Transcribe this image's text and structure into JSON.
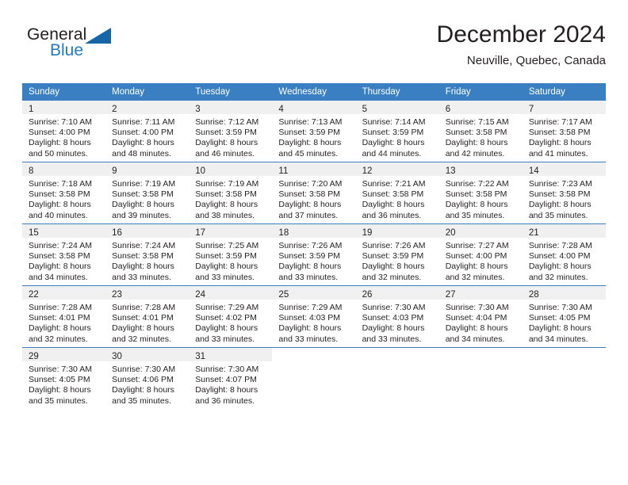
{
  "brand": {
    "name_part1": "General",
    "name_part2": "Blue",
    "flag_color": "#1565a8",
    "blue_color": "#1f7bc1"
  },
  "header": {
    "title": "December 2024",
    "subtitle": "Neuville, Quebec, Canada"
  },
  "theme": {
    "header_bar_color": "#3a7fc1",
    "day_band_color": "#f0f0f0",
    "text_color": "#231f20"
  },
  "weekdays": [
    "Sunday",
    "Monday",
    "Tuesday",
    "Wednesday",
    "Thursday",
    "Friday",
    "Saturday"
  ],
  "weeks": [
    [
      {
        "day": "1",
        "sunrise": "Sunrise: 7:10 AM",
        "sunset": "Sunset: 4:00 PM",
        "daylight1": "Daylight: 8 hours",
        "daylight2": "and 50 minutes."
      },
      {
        "day": "2",
        "sunrise": "Sunrise: 7:11 AM",
        "sunset": "Sunset: 4:00 PM",
        "daylight1": "Daylight: 8 hours",
        "daylight2": "and 48 minutes."
      },
      {
        "day": "3",
        "sunrise": "Sunrise: 7:12 AM",
        "sunset": "Sunset: 3:59 PM",
        "daylight1": "Daylight: 8 hours",
        "daylight2": "and 46 minutes."
      },
      {
        "day": "4",
        "sunrise": "Sunrise: 7:13 AM",
        "sunset": "Sunset: 3:59 PM",
        "daylight1": "Daylight: 8 hours",
        "daylight2": "and 45 minutes."
      },
      {
        "day": "5",
        "sunrise": "Sunrise: 7:14 AM",
        "sunset": "Sunset: 3:59 PM",
        "daylight1": "Daylight: 8 hours",
        "daylight2": "and 44 minutes."
      },
      {
        "day": "6",
        "sunrise": "Sunrise: 7:15 AM",
        "sunset": "Sunset: 3:58 PM",
        "daylight1": "Daylight: 8 hours",
        "daylight2": "and 42 minutes."
      },
      {
        "day": "7",
        "sunrise": "Sunrise: 7:17 AM",
        "sunset": "Sunset: 3:58 PM",
        "daylight1": "Daylight: 8 hours",
        "daylight2": "and 41 minutes."
      }
    ],
    [
      {
        "day": "8",
        "sunrise": "Sunrise: 7:18 AM",
        "sunset": "Sunset: 3:58 PM",
        "daylight1": "Daylight: 8 hours",
        "daylight2": "and 40 minutes."
      },
      {
        "day": "9",
        "sunrise": "Sunrise: 7:19 AM",
        "sunset": "Sunset: 3:58 PM",
        "daylight1": "Daylight: 8 hours",
        "daylight2": "and 39 minutes."
      },
      {
        "day": "10",
        "sunrise": "Sunrise: 7:19 AM",
        "sunset": "Sunset: 3:58 PM",
        "daylight1": "Daylight: 8 hours",
        "daylight2": "and 38 minutes."
      },
      {
        "day": "11",
        "sunrise": "Sunrise: 7:20 AM",
        "sunset": "Sunset: 3:58 PM",
        "daylight1": "Daylight: 8 hours",
        "daylight2": "and 37 minutes."
      },
      {
        "day": "12",
        "sunrise": "Sunrise: 7:21 AM",
        "sunset": "Sunset: 3:58 PM",
        "daylight1": "Daylight: 8 hours",
        "daylight2": "and 36 minutes."
      },
      {
        "day": "13",
        "sunrise": "Sunrise: 7:22 AM",
        "sunset": "Sunset: 3:58 PM",
        "daylight1": "Daylight: 8 hours",
        "daylight2": "and 35 minutes."
      },
      {
        "day": "14",
        "sunrise": "Sunrise: 7:23 AM",
        "sunset": "Sunset: 3:58 PM",
        "daylight1": "Daylight: 8 hours",
        "daylight2": "and 35 minutes."
      }
    ],
    [
      {
        "day": "15",
        "sunrise": "Sunrise: 7:24 AM",
        "sunset": "Sunset: 3:58 PM",
        "daylight1": "Daylight: 8 hours",
        "daylight2": "and 34 minutes."
      },
      {
        "day": "16",
        "sunrise": "Sunrise: 7:24 AM",
        "sunset": "Sunset: 3:58 PM",
        "daylight1": "Daylight: 8 hours",
        "daylight2": "and 33 minutes."
      },
      {
        "day": "17",
        "sunrise": "Sunrise: 7:25 AM",
        "sunset": "Sunset: 3:59 PM",
        "daylight1": "Daylight: 8 hours",
        "daylight2": "and 33 minutes."
      },
      {
        "day": "18",
        "sunrise": "Sunrise: 7:26 AM",
        "sunset": "Sunset: 3:59 PM",
        "daylight1": "Daylight: 8 hours",
        "daylight2": "and 33 minutes."
      },
      {
        "day": "19",
        "sunrise": "Sunrise: 7:26 AM",
        "sunset": "Sunset: 3:59 PM",
        "daylight1": "Daylight: 8 hours",
        "daylight2": "and 32 minutes."
      },
      {
        "day": "20",
        "sunrise": "Sunrise: 7:27 AM",
        "sunset": "Sunset: 4:00 PM",
        "daylight1": "Daylight: 8 hours",
        "daylight2": "and 32 minutes."
      },
      {
        "day": "21",
        "sunrise": "Sunrise: 7:28 AM",
        "sunset": "Sunset: 4:00 PM",
        "daylight1": "Daylight: 8 hours",
        "daylight2": "and 32 minutes."
      }
    ],
    [
      {
        "day": "22",
        "sunrise": "Sunrise: 7:28 AM",
        "sunset": "Sunset: 4:01 PM",
        "daylight1": "Daylight: 8 hours",
        "daylight2": "and 32 minutes."
      },
      {
        "day": "23",
        "sunrise": "Sunrise: 7:28 AM",
        "sunset": "Sunset: 4:01 PM",
        "daylight1": "Daylight: 8 hours",
        "daylight2": "and 32 minutes."
      },
      {
        "day": "24",
        "sunrise": "Sunrise: 7:29 AM",
        "sunset": "Sunset: 4:02 PM",
        "daylight1": "Daylight: 8 hours",
        "daylight2": "and 33 minutes."
      },
      {
        "day": "25",
        "sunrise": "Sunrise: 7:29 AM",
        "sunset": "Sunset: 4:03 PM",
        "daylight1": "Daylight: 8 hours",
        "daylight2": "and 33 minutes."
      },
      {
        "day": "26",
        "sunrise": "Sunrise: 7:30 AM",
        "sunset": "Sunset: 4:03 PM",
        "daylight1": "Daylight: 8 hours",
        "daylight2": "and 33 minutes."
      },
      {
        "day": "27",
        "sunrise": "Sunrise: 7:30 AM",
        "sunset": "Sunset: 4:04 PM",
        "daylight1": "Daylight: 8 hours",
        "daylight2": "and 34 minutes."
      },
      {
        "day": "28",
        "sunrise": "Sunrise: 7:30 AM",
        "sunset": "Sunset: 4:05 PM",
        "daylight1": "Daylight: 8 hours",
        "daylight2": "and 34 minutes."
      }
    ],
    [
      {
        "day": "29",
        "sunrise": "Sunrise: 7:30 AM",
        "sunset": "Sunset: 4:05 PM",
        "daylight1": "Daylight: 8 hours",
        "daylight2": "and 35 minutes."
      },
      {
        "day": "30",
        "sunrise": "Sunrise: 7:30 AM",
        "sunset": "Sunset: 4:06 PM",
        "daylight1": "Daylight: 8 hours",
        "daylight2": "and 35 minutes."
      },
      {
        "day": "31",
        "sunrise": "Sunrise: 7:30 AM",
        "sunset": "Sunset: 4:07 PM",
        "daylight1": "Daylight: 8 hours",
        "daylight2": "and 36 minutes."
      },
      {
        "day": "",
        "sunrise": "",
        "sunset": "",
        "daylight1": "",
        "daylight2": ""
      },
      {
        "day": "",
        "sunrise": "",
        "sunset": "",
        "daylight1": "",
        "daylight2": ""
      },
      {
        "day": "",
        "sunrise": "",
        "sunset": "",
        "daylight1": "",
        "daylight2": ""
      },
      {
        "day": "",
        "sunrise": "",
        "sunset": "",
        "daylight1": "",
        "daylight2": ""
      }
    ]
  ]
}
